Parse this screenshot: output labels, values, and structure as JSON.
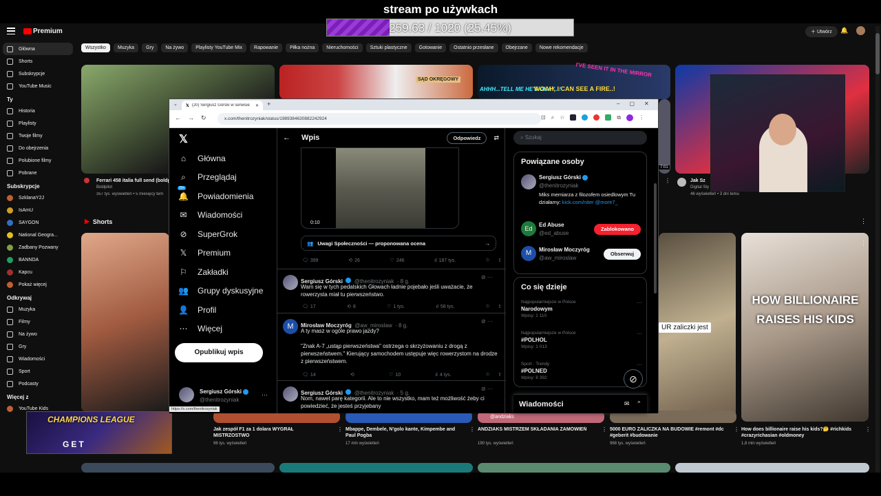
{
  "overlay": {
    "stream_title": "stream po używkach",
    "progress_text": "259.63 / 1020 (25.45%)",
    "progress_fraction": 0.2545
  },
  "youtube": {
    "brand": "Premium",
    "create_label": "Utwórz",
    "chips": [
      "Wszystko",
      "Muzyka",
      "Gry",
      "Na żywo",
      "Playlisty YouTube Mix",
      "Rapowanie",
      "Piłka nożna",
      "Nieruchomości",
      "Sztuki plastyczne",
      "Gotowanie",
      "Ostatnio przesłane",
      "Obejrzane",
      "Nowe rekomendacje"
    ],
    "sidebar_main": [
      "Główna",
      "Shorts",
      "Subskrypcje",
      "YouTube Music"
    ],
    "sidebar_you_header": "Ty",
    "sidebar_you": [
      "Historia",
      "Playlisty",
      "Twoje filmy",
      "Do obejrzenia",
      "Polubione filmy",
      "Pobrane"
    ],
    "sidebar_subs_header": "Subskrypcje",
    "sidebar_subs": [
      "SzklanaY2J",
      "IsAmU",
      "SAYGON",
      "National Geogra...",
      "Zadbany Pozwany",
      "BANNDA",
      "Kapcu",
      "Pokaż więcej"
    ],
    "sidebar_explore_header": "Odkrywaj",
    "sidebar_explore": [
      "Muzyka",
      "Filmy",
      "Na żywo",
      "Gry",
      "Wiadomości",
      "Sport",
      "Podcasty"
    ],
    "sidebar_more_header": "Więcej z",
    "sidebar_more": [
      "YouTube Kids"
    ],
    "video1": {
      "title": "Ferrari 458 italia full send (boldp",
      "channel": "Boldpilot",
      "meta": "357 tys. wyświetleń • 5 miesięcy tem"
    },
    "video4": {
      "title": "Jak Sz",
      "channel": "Digital Sty",
      "meta": "46 wyświetleń • 3 dni temu",
      "duration": "7:01"
    },
    "thumb3_text_a": "AHHH...TELL ME HE'S OKAY...!",
    "thumb3_text_b": "WOAH, I CAN SEE A FIRE..!",
    "thumb3_text_c": "I'VE SEEN IT IN THE MIRROR",
    "thumb2_text": "SĄD OKRĘGOWY",
    "shorts_label": "Shorts",
    "shorts": [
      {
        "title": "Jak zespół F1 za 1 dolara WYGRAŁ MISTRZOSTWO",
        "meta": "96 tys. wyświetleń"
      },
      {
        "title": "Mbappe, Dembele, N'golo kante, Kimpembe and Paul Pogba",
        "meta": "17 mln wyświetleń"
      },
      {
        "title": "ANDZIAKS MISTRZEM SKŁADANIA ZAMÓWIEŃ",
        "meta": "190 tys. wyświetleń"
      },
      {
        "title": "5000 EURO ZALICZKA NA BUDOWIE #remont #dc #geberit #budowanie",
        "meta": "968 tys. wyświetleń"
      },
      {
        "title": "How does billionaire raise his kids?🤔 #richkids #crazyrichasian #oldmoney",
        "meta": "1,8 mln wyświetleń"
      }
    ],
    "short4_caption": "UR zaliczki jest",
    "short5_caption": "HOW BILLIONAIRE RAISES HIS KIDS",
    "short3_tag": "@andziaks",
    "promo_text": "CHAMPIONS LEAGUE",
    "promo_sub": "GET"
  },
  "browser": {
    "tab_title": "(20) Sergiusz Górski w serwisie",
    "url": "x.com/thenitrozyniak/status/1989384630882242924",
    "status_url": "https://x.com/thenitrozyniak"
  },
  "x": {
    "nav": [
      {
        "label": "Główna",
        "icon": "home-icon"
      },
      {
        "label": "Przeglądaj",
        "icon": "search-icon"
      },
      {
        "label": "Powiadomienia",
        "icon": "bell-icon",
        "badge": "20+"
      },
      {
        "label": "Wiadomości",
        "icon": "mail-icon"
      },
      {
        "label": "SuperGrok",
        "icon": "grok-icon"
      },
      {
        "label": "Premium",
        "icon": "x-icon"
      },
      {
        "label": "Zakładki",
        "icon": "bookmark-icon"
      },
      {
        "label": "Grupy dyskusyjne",
        "icon": "people-icon"
      },
      {
        "label": "Profil",
        "icon": "person-icon"
      },
      {
        "label": "Więcej",
        "icon": "more-icon"
      }
    ],
    "post_button": "Opublikuj wpis",
    "account": {
      "name": "Sergiusz Górski",
      "handle": "@thenitrozyniak"
    },
    "header": {
      "title": "Wpis",
      "reply_button": "Odpowiedz"
    },
    "video_time": "0:10",
    "community_note": "Uwagi Społeczności — proponowana ocena",
    "main_stats": {
      "replies": "399",
      "reposts": "26",
      "likes": "246",
      "views": "187 tys."
    },
    "tweets": [
      {
        "name": "Sergiusz Górski",
        "handle": "@thenitrozyniak",
        "time": "· 8 g.",
        "text": "Wam się w tych pedalskich Głowach ładnie pojebało jeśli uważacie, że rowerzysta miał tu pierwszeństwo.",
        "replies": "17",
        "reposts": "8",
        "likes": "1 tys.",
        "views": "58 tys."
      },
      {
        "name": "Mirosław Moczyróg",
        "handle": "@aw_miroslaw",
        "time": "· 8 g.",
        "text1": "A ty masz w ogóle prawo jazdy?",
        "text2": "\"Znak A-7 „ustąp pierwszeństwa\" ostrzega o skrzyżowaniu z drogą z pierwszeństwem.\" Kierujący samochodem ustępuje więc rowerzystom na drodze z pierwszeństwem.",
        "replies": "14",
        "reposts": "",
        "likes": "10",
        "views": "4 tys."
      },
      {
        "name": "Sergiusz Górski",
        "handle": "@thenitrozyniak",
        "time": "· 5 g.",
        "text": "Nom, nawet parę kategorii. Ale to nie wszystko, mam też możliwość żeby ci powiedzieć, że jesteś przyjebany"
      }
    ],
    "search_placeholder": "Szukaj",
    "related_title": "Powiązane osoby",
    "related": [
      {
        "name": "Sergiusz Górski",
        "handle": "@thenitrozyniak",
        "bio": "Miks memiarza z filozofem osiedlowym Tu działamy:",
        "link": "kick.com/niter @more7_"
      },
      {
        "name": "Ed Abuse",
        "handle": "@ed_abuse",
        "button": "Zablokowano",
        "avatar": "Ed"
      },
      {
        "name": "Mirosław Moczyróg",
        "handle": "@aw_miroslaw",
        "button": "Obserwuj",
        "avatar": "M"
      }
    ],
    "trends_title": "Co się dzieje",
    "trends": [
      {
        "context": "Najpopularniejsze w Polsce",
        "name": "Narodowym",
        "count": "Wpisy: 1 110"
      },
      {
        "context": "Najpopularniejsze w Polsce",
        "name": "#POLHOL",
        "count": "Wpisy: 1 013"
      },
      {
        "context": "Sport · Trendy",
        "name": "#POLNED",
        "count": "Wpisy: 8 392"
      }
    ],
    "messages_title": "Wiadomości"
  },
  "colors": {
    "accent_blue": "#1d9bf0",
    "yt_red": "#ff0000",
    "block_red": "#f4212e",
    "progress_purple": "#8a2be2"
  }
}
